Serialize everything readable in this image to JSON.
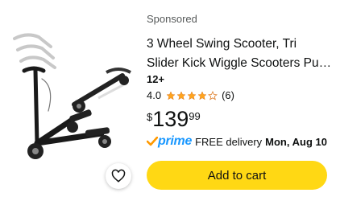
{
  "listing": {
    "sponsored_label": "Sponsored",
    "title_line1": "3 Wheel Swing Scooter, Tri",
    "title_line2": "Slider Kick Wiggle Scooters Pu…",
    "age": "12+",
    "rating": "4.0",
    "stars_filled": 4,
    "stars_total": 5,
    "review_count": "(6)",
    "price": {
      "symbol": "$",
      "whole": "139",
      "fraction": "99"
    },
    "delivery": {
      "prime": "prime",
      "free_text": "FREE delivery",
      "date": "Mon, Aug 10"
    },
    "add_to_cart_label": "Add to cart"
  },
  "colors": {
    "add_button": "#ffd814",
    "star": "#ffa41c",
    "prime": "#1a98ff",
    "prime_check": "#ff9900",
    "muted_text": "#565959"
  },
  "icons": {
    "favorite": "heart-outline-icon",
    "prime": "prime-check-icon",
    "star": "star-icon"
  }
}
